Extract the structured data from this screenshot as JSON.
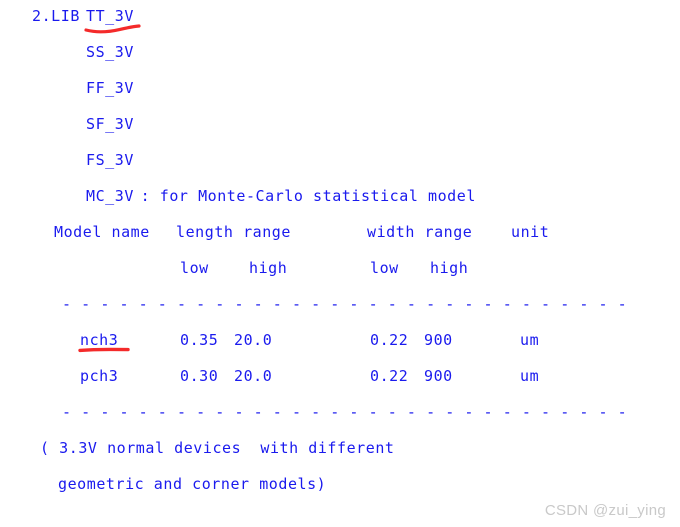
{
  "document": {
    "title": "2.LIB corner model list",
    "text_color": "#1a1aee",
    "annotation_color": "#f42a2a",
    "background_color": "#ffffff"
  },
  "section": {
    "index_label": "2.LIB",
    "corners": [
      {
        "name": "TT_3V",
        "note": ""
      },
      {
        "name": "SS_3V",
        "note": ""
      },
      {
        "name": "FF_3V",
        "note": ""
      },
      {
        "name": "SF_3V",
        "note": ""
      },
      {
        "name": "FS_3V",
        "note": ""
      },
      {
        "name": "MC_3V",
        "note": " : for Monte-Carlo statistical model"
      }
    ]
  },
  "table": {
    "header_row1": {
      "model_name": "Model name",
      "length_range": "length range",
      "width_range": "width range",
      "unit": "unit"
    },
    "header_row2": {
      "length_low": "low",
      "length_high": "high",
      "width_low": "low",
      "width_high": "high"
    },
    "separator": "- - - - - - - - - - - - - - - - - - - - - - - - - - - - - -",
    "rows": [
      {
        "model": "nch3",
        "length_low": "0.35",
        "length_high": "20.0",
        "width_low": "0.22",
        "width_high": "900",
        "unit": "um"
      },
      {
        "model": "pch3",
        "length_low": "0.30",
        "length_high": "20.0",
        "width_low": "0.22",
        "width_high": "900",
        "unit": "um"
      }
    ]
  },
  "footer": {
    "line1": "( 3.3V normal devices  with different",
    "line2": "geometric and corner models)"
  },
  "annotations": [
    {
      "name": "underline-tt-3v",
      "target": "TT_3V"
    },
    {
      "name": "underline-nch3",
      "target": "nch3"
    }
  ],
  "watermark": {
    "text": "CSDN @zui_ying"
  }
}
